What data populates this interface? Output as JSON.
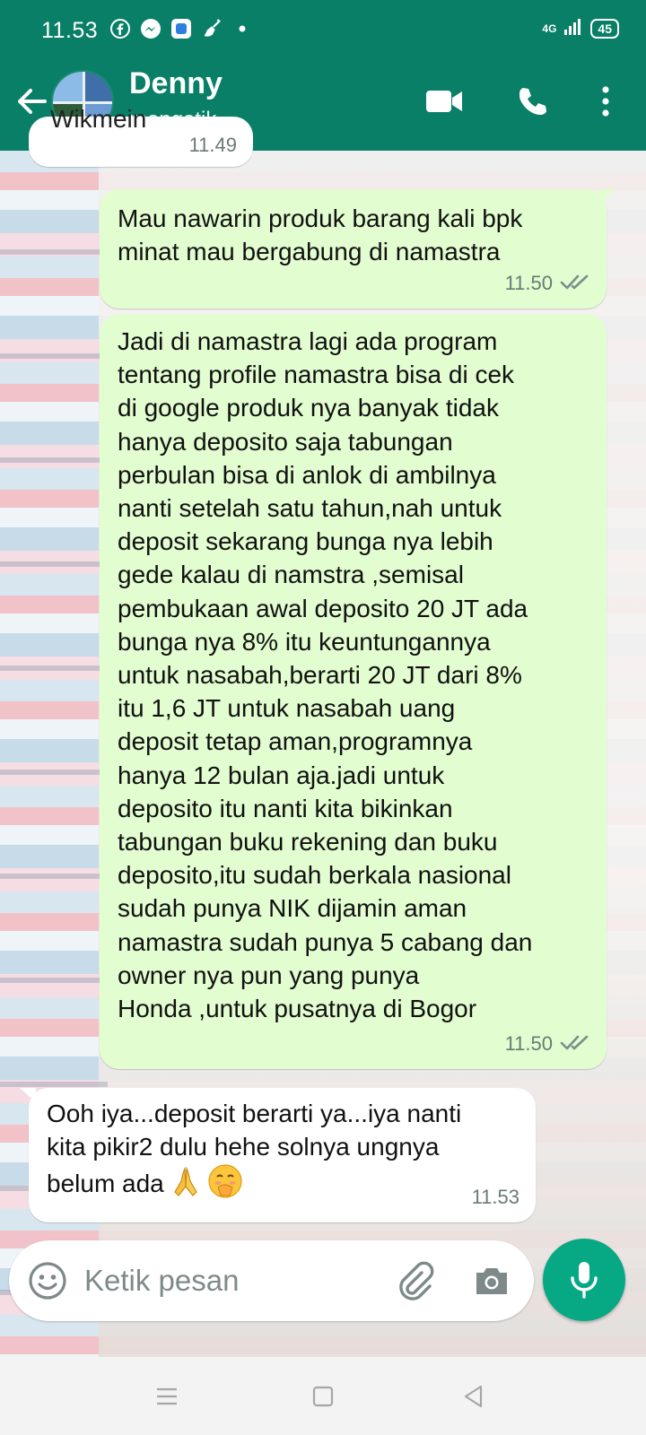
{
  "status_bar": {
    "time": "11.53",
    "network": "4G",
    "battery": "45",
    "icons": [
      "facebook-icon",
      "messenger-icon",
      "app-icon",
      "cleaner-icon",
      "dot-icon"
    ]
  },
  "header": {
    "contact_name": "Denny",
    "contact_status": "mengetik..."
  },
  "messages": [
    {
      "direction": "incoming",
      "text": "",
      "time": "11.49",
      "partial": true,
      "partial_text": "Wikmein"
    },
    {
      "direction": "outgoing",
      "text": "Mau nawarin produk barang kali bpk\nminat mau bergabung di namastra",
      "time": "11.50",
      "status": "read"
    },
    {
      "direction": "outgoing",
      "text": "Jadi di namastra lagi ada program\ntentang profile namastra bisa di cek\ndi google produk nya banyak tidak\nhanya deposito saja tabungan\nperbulan bisa di anlok di ambilnya\nnanti setelah satu tahun,nah untuk\ndeposit sekarang bunga nya lebih\ngede kalau di namstra ,semisal\npembukaan awal deposito 20 JT ada\nbunga nya 8% itu keuntungannya\nuntuk nasabah,berarti 20 JT dari 8%\nitu 1,6 JT untuk nasabah uang\ndeposit tetap aman,programnya\nhanya 12 bulan aja.jadi untuk\ndeposito itu nanti kita bikinkan\ntabungan buku rekening dan buku\ndeposito,itu sudah berkala nasional\nsudah punya NIK dijamin aman\nnamastra sudah punya 5 cabang dan\nowner nya pun yang punya\nHonda ,untuk pusatnya di Bogor",
      "time": "11.50",
      "status": "read"
    },
    {
      "direction": "incoming",
      "text": "Ooh iya...deposit berarti ya...iya nanti\nkita pikir2 dulu hehe solnya ungnya\nbelum ada",
      "emojis": [
        "folded-hands-emoji",
        "hand-over-mouth-emoji"
      ],
      "time": "11.53"
    }
  ],
  "composer": {
    "placeholder": "Ketik pesan"
  },
  "colors": {
    "header": "#087f66",
    "outgoing_bubble": "#e2fdd0",
    "incoming_bubble": "#ffffff",
    "mic_button": "#07a884",
    "read_ticks": "#7a8f8a"
  }
}
